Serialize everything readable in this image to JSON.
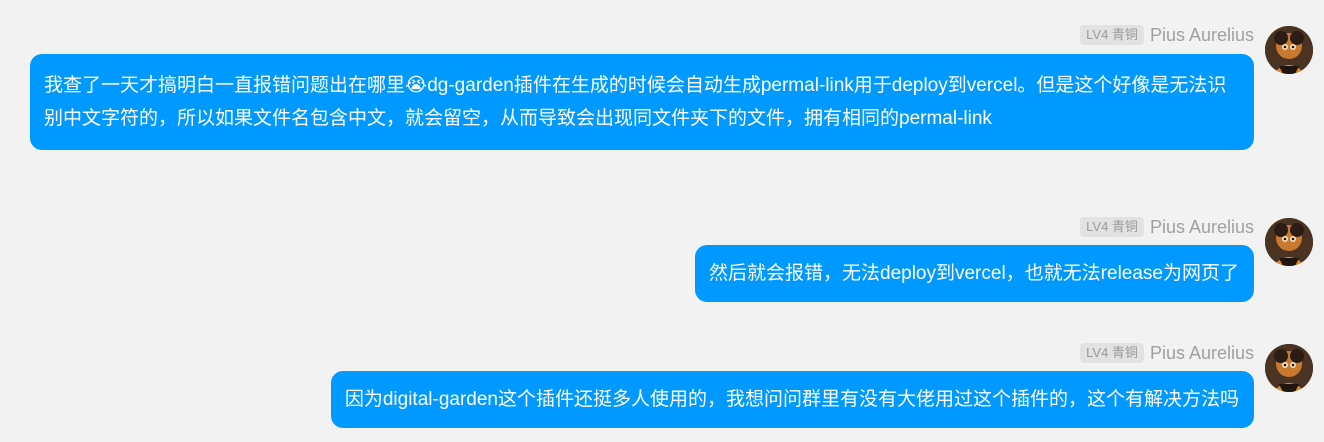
{
  "messages": [
    {
      "badge": "LV4 青铜",
      "sender": "Pius Aurelius",
      "text_before_emoji": "我查了一天才搞明白一直报错问题出在哪里",
      "emoji": "😭",
      "text_after_emoji": "dg-garden插件在生成的时候会自动生成permal-link用于deploy到vercel。但是这个好像是无法识别中文字符的，所以如果文件名包含中文，就会留空，从而导致会出现同文件夹下的文件，拥有相同的permal-link"
    },
    {
      "badge": "LV4 青铜",
      "sender": "Pius Aurelius",
      "text": "然后就会报错，无法deploy到vercel，也就无法release为网页了"
    },
    {
      "badge": "LV4 青铜",
      "sender": "Pius Aurelius",
      "text": "因为digital-garden这个插件还挺多人使用的，我想问问群里有没有大佬用过这个插件的，这个有解决方法吗"
    }
  ],
  "colors": {
    "bubble": "#0099ff",
    "background": "#f2f2f2",
    "badge_bg": "#e2e2e2",
    "badge_text": "#9a9a9a",
    "sender_text": "#a0a0a0"
  }
}
